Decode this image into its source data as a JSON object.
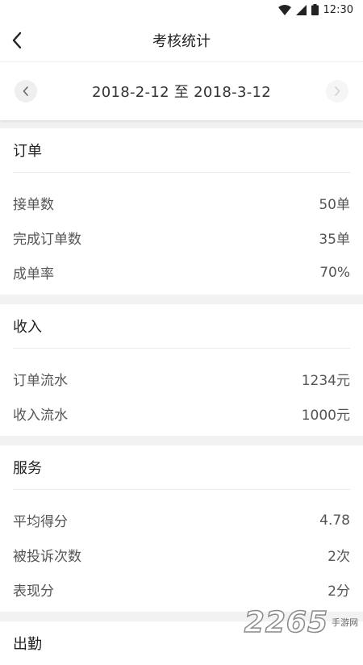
{
  "status_bar": {
    "time": "12:30"
  },
  "nav": {
    "title": "考核统计",
    "back_icon": "chevron-left-icon"
  },
  "date_bar": {
    "range": "2018-2-12 至 2018-3-12"
  },
  "sections": [
    {
      "title": "订单",
      "rows": [
        {
          "label": "接单数",
          "value": "50单"
        },
        {
          "label": "完成订单数",
          "value": "35单"
        },
        {
          "label": "成单率",
          "value": "70%"
        }
      ]
    },
    {
      "title": "收入",
      "rows": [
        {
          "label": "订单流水",
          "value": "1234元"
        },
        {
          "label": "收入流水",
          "value": "1000元"
        }
      ]
    },
    {
      "title": "服务",
      "rows": [
        {
          "label": "平均得分",
          "value": "4.78"
        },
        {
          "label": "被投诉次数",
          "value": "2次"
        },
        {
          "label": "表现分",
          "value": "2分"
        }
      ]
    },
    {
      "title": "出勤",
      "rows": []
    }
  ],
  "watermark": {
    "number": "2265",
    "suffix_top": "手游网",
    "suffix_bottom": ""
  }
}
